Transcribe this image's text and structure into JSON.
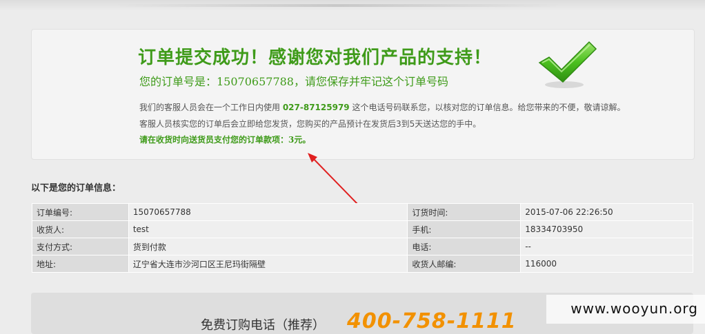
{
  "success": {
    "title": "订单提交成功！感谢您对我们产品的支持！",
    "order_number_line": "您的订单号是：15070657788，请您保存并牢记这个订单号码",
    "info_line1_pre": "我们的客服人员会在一个工作日内使用 ",
    "info_phone": "027-87125979",
    "info_line1_post": " 这个电话号码联系您，以核对您的订单信息。给您带来的不便，敬请谅解。",
    "info_line2": "客服人员核实您的订单后会立即给您发货，您购买的产品预计在发货后3到5天送达您的手中。",
    "pay_note": "请在收货时向送货员支付您的订单款项：3元。",
    "check_icon": "checkmark-icon",
    "accent_color": "#3f9b1a"
  },
  "section_heading": "以下是您的订单信息：",
  "order_table": [
    {
      "k1": "订单编号:",
      "v1": "15070657788",
      "k2": "订货时间:",
      "v2": "2015-07-06 22:26:50"
    },
    {
      "k1": "收货人:",
      "v1": "test",
      "k2": "手机:",
      "v2": "18334703950"
    },
    {
      "k1": "支付方式:",
      "v1": "货到付款",
      "k2": "电话:",
      "v2": "--"
    },
    {
      "k1": "地址:",
      "v1": "辽宁省大连市沙河口区王尼玛街隔壁",
      "k2": "收货人邮编:",
      "v2": "116000"
    }
  ],
  "hotline": {
    "label": "免费订购电话（推荐）",
    "number": "400-758-1111",
    "number_color": "#f29100"
  },
  "watermark": "www.wooyun.org",
  "annotation": {
    "arrow_color": "#e02020"
  }
}
